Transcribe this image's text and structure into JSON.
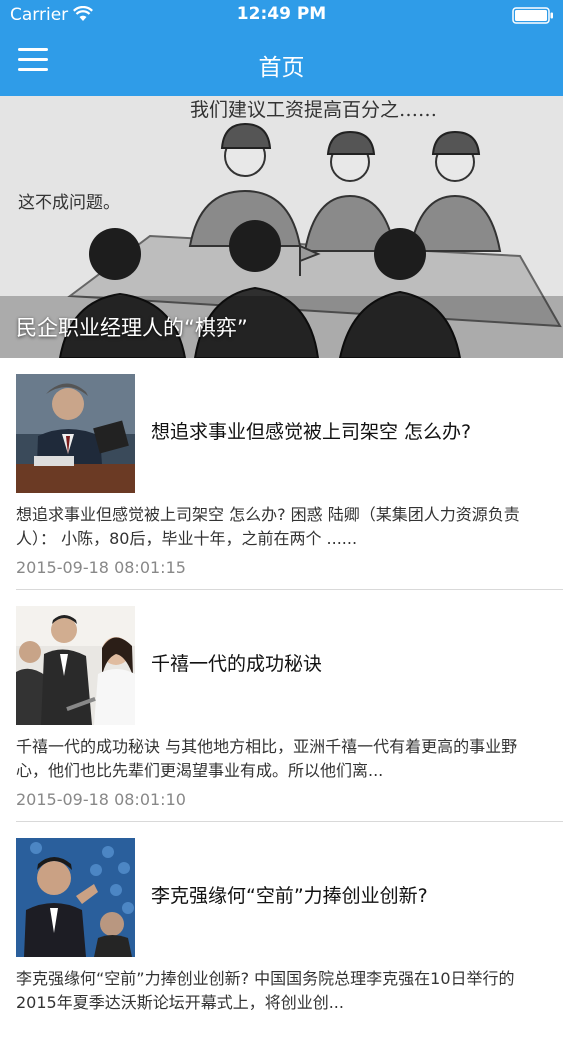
{
  "status_bar": {
    "carrier": "Carrier",
    "time": "12:49 PM"
  },
  "nav": {
    "title": "首页",
    "menu_icon": "hamburger-menu-icon"
  },
  "banner": {
    "caption": "民企职业经理人的“棋弈”",
    "sketch_text_top": "我们建议工资提高百分之……",
    "sketch_text_left": "这不成问题。"
  },
  "articles": [
    {
      "title": "想追求事业但感觉被上司架空 怎么办?",
      "summary": "想追求事业但感觉被上司架空 怎么办? 困惑 陆卿（某集团人力资源负责人）： 小陈，80后，毕业十年，之前在两个 ......",
      "time": "2015-09-18 08:01:15"
    },
    {
      "title": "千禧一代的成功秘诀",
      "summary": "千禧一代的成功秘诀 与其他地方相比，亚洲千禧一代有着更高的事业野心，他们也比先辈们更渴望事业有成。所以他们离...",
      "time": "2015-09-18 08:01:10"
    },
    {
      "title": "李克强缘何“空前”力捧创业创新?",
      "summary": "李克强缘何“空前”力捧创业创新? 中国国务院总理李克强在10日举行的2015年夏季达沃斯论坛开幕式上，将创业创...",
      "time": ""
    }
  ],
  "colors": {
    "header_bg": "#2f9ce8",
    "time_text": "#888888",
    "divider": "#d9d9d9"
  }
}
